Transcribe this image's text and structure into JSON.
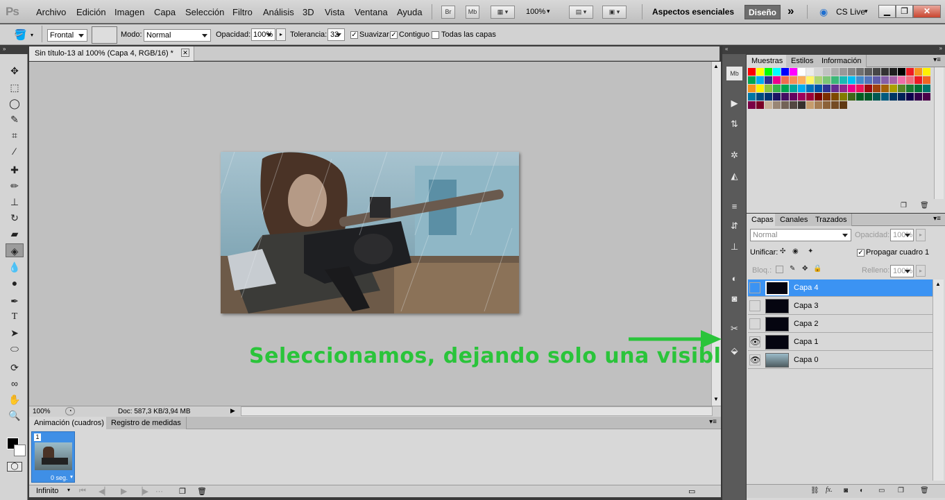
{
  "app": {
    "logo": "Ps"
  },
  "menu": [
    "Archivo",
    "Edición",
    "Imagen",
    "Capa",
    "Selección",
    "Filtro",
    "Análisis",
    "3D",
    "Vista",
    "Ventana",
    "Ayuda"
  ],
  "topbar": {
    "br": "Br",
    "mb": "Mb",
    "zoom": "100%",
    "workspace": "Aspectos esenciales",
    "design": "Diseño",
    "cslive": "CS Live",
    "more": "»"
  },
  "options": {
    "preset": "Frontal",
    "mode_label": "Modo:",
    "mode": "Normal",
    "opacity_label": "Opacidad:",
    "opacity": "100%",
    "tolerance_label": "Tolerancia:",
    "tolerance": "32",
    "smooth": "Suavizar",
    "contiguous": "Contiguo",
    "all_layers": "Todas las capas"
  },
  "document": {
    "tab_title": "Sin título-13 al 100% (Capa 4, RGB/16) *",
    "zoom": "100%",
    "doc_info": "Doc: 587,3 KB/3,94 MB"
  },
  "annotation": "Seleccionamos, dejando solo una visible",
  "animation": {
    "tabs": [
      "Animación (cuadros)",
      "Registro de medidas"
    ],
    "frame_number": "1",
    "frame_delay": "0 seg.",
    "loop": "Infinito"
  },
  "swatches_panel": {
    "tabs": [
      "Muestras",
      "Estilos",
      "Información"
    ],
    "colors": [
      "#ff0000",
      "#ffff00",
      "#00ff00",
      "#00ffff",
      "#0000ff",
      "#ff00ff",
      "#ffffff",
      "#ebebeb",
      "#d6d6d6",
      "#c2c2c2",
      "#adadad",
      "#999999",
      "#858585",
      "#707070",
      "#5c5c5c",
      "#474747",
      "#333333",
      "#1f1f1f",
      "#000000",
      "#ed1c24",
      "#f7941d",
      "#fff200",
      "#00a651",
      "#00aeef",
      "#2e3192",
      "#ec008c",
      "#f26c4f",
      "#f68e55",
      "#fbaf5c",
      "#fff467",
      "#acd372",
      "#7cc576",
      "#3bb878",
      "#1abbb4",
      "#00bff3",
      "#438ccb",
      "#5574b9",
      "#605ca8",
      "#855fa8",
      "#a763a8",
      "#f06ea9",
      "#f26d7d",
      "#ed1c24",
      "#f26522",
      "#f7941d",
      "#fff200",
      "#8dc63f",
      "#39b54a",
      "#00a651",
      "#00a99d",
      "#00aeef",
      "#0072bc",
      "#0054a6",
      "#2e3192",
      "#662d91",
      "#92278f",
      "#ec008c",
      "#ed145b",
      "#9e0b0f",
      "#a0410d",
      "#a36209",
      "#aba000",
      "#598527",
      "#1a7b30",
      "#007236",
      "#00746b",
      "#0076a3",
      "#004b80",
      "#003471",
      "#1b1464",
      "#440e62",
      "#630460",
      "#9e005d",
      "#9e0039",
      "#790000",
      "#7b2e00",
      "#7d4900",
      "#827b00",
      "#406618",
      "#005e20",
      "#005826",
      "#005952",
      "#005b7f",
      "#003663",
      "#002157",
      "#0d004c",
      "#32004b",
      "#4b0049",
      "#7b0046",
      "#7a0026",
      "#c7b299",
      "#998675",
      "#736357",
      "#534741",
      "#37302d",
      "#c69c6d",
      "#a67c52",
      "#8c6239",
      "#754c24",
      "#603913"
    ],
    "footer_icons": [
      "new-swatch-icon",
      "delete-icon"
    ]
  },
  "layers_panel": {
    "tabs": [
      "Capas",
      "Canales",
      "Trazados"
    ],
    "blend": "Normal",
    "opacity_label": "Opacidad:",
    "opacity": "100%",
    "unify_label": "Unificar:",
    "propagate": "Propagar cuadro 1",
    "lock_label": "Bloq.:",
    "fill_label": "Relleno:",
    "fill": "100%",
    "layers": [
      {
        "name": "Capa 4",
        "visible": false,
        "selected": true
      },
      {
        "name": "Capa 3",
        "visible": false,
        "selected": false
      },
      {
        "name": "Capa 2",
        "visible": false,
        "selected": false
      },
      {
        "name": "Capa 1",
        "visible": true,
        "selected": false
      },
      {
        "name": "Capa 0",
        "visible": true,
        "selected": false
      }
    ]
  },
  "colors": {
    "accent": "#3b93f3",
    "annotation": "#2ac43a"
  }
}
